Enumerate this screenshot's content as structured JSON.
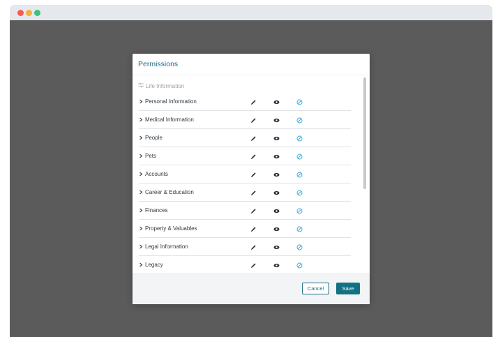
{
  "window": {
    "controls": [
      "close-dot",
      "minimize-dot",
      "maximize-dot"
    ]
  },
  "modal": {
    "title": "Permissions",
    "section": {
      "icon": "sliders-icon",
      "label": "Life Information"
    },
    "rows": [
      {
        "label": "Personal Information"
      },
      {
        "label": "Medical Information"
      },
      {
        "label": "People"
      },
      {
        "label": "Pets"
      },
      {
        "label": "Accounts"
      },
      {
        "label": "Career & Education"
      },
      {
        "label": "Finances"
      },
      {
        "label": "Property & Valuables"
      },
      {
        "label": "Legal Information"
      },
      {
        "label": "Legacy"
      }
    ],
    "row_icons": {
      "edit": "pencil-icon",
      "view": "eye-icon",
      "deny": "block-icon"
    },
    "colors": {
      "accent": "#137185",
      "title": "#1e6f86",
      "deny_icon": "#3aa7d6"
    },
    "footer": {
      "cancel_label": "Cancel",
      "save_label": "Save"
    }
  }
}
